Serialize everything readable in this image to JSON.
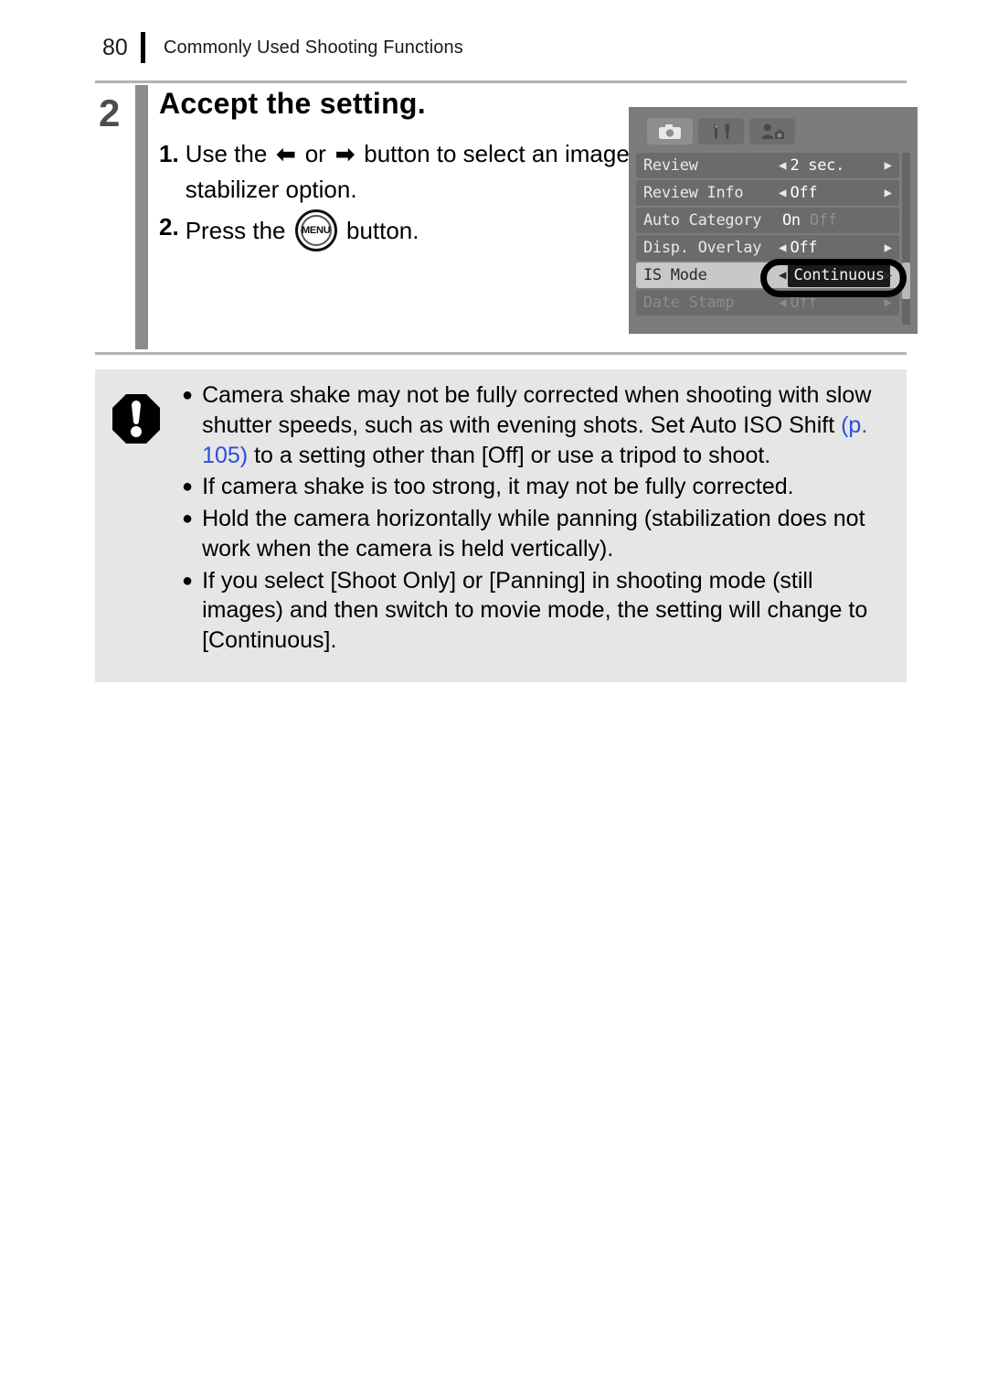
{
  "header": {
    "page_number": "80",
    "title": "Commonly Used Shooting Functions"
  },
  "step": {
    "number": "2",
    "title": "Accept the setting.",
    "substeps": [
      {
        "num": "1.",
        "text_before": "Use the",
        "arrow_left": "⬅",
        "between": "or",
        "arrow_right": "➡",
        "text_after": "button to select an image stabilizer option."
      },
      {
        "num": "2.",
        "text_before": "Press the",
        "button_label": "MENU",
        "text_after": "button."
      }
    ]
  },
  "lcd": {
    "tabs": [
      {
        "name": "camera-tab",
        "icon": "camera-icon",
        "active": true
      },
      {
        "name": "tools-tab",
        "icon": "wrench-screwdriver-icon",
        "active": false
      },
      {
        "name": "my-camera-tab",
        "icon": "person-camera-icon",
        "active": false
      }
    ],
    "rows": [
      {
        "label": "Review",
        "value": "2 sec.",
        "style": "arrows"
      },
      {
        "label": "Review Info",
        "value": "Off",
        "style": "arrows"
      },
      {
        "label": "Auto Category",
        "value_on": "On",
        "value_off": "Off",
        "style": "onoff"
      },
      {
        "label": "Disp. Overlay",
        "value": "Off",
        "style": "arrows"
      },
      {
        "label": "IS Mode",
        "value": "Continuous",
        "style": "selected"
      },
      {
        "label": "Date Stamp",
        "value": "Off",
        "style": "arrows-faded"
      }
    ],
    "caret_left": "◀",
    "caret_right": "▶"
  },
  "caution": {
    "icon": "exclamation-octagon-icon",
    "items": [
      {
        "text_before": "Camera shake may not be fully corrected when shooting with slow shutter speeds, such as with evening shots. Set Auto ISO Shift ",
        "link": "(p. 105)",
        "text_after": " to a setting other than [Off] or use a tripod to shoot."
      },
      {
        "text_before": "If camera shake is too strong, it may not be fully corrected."
      },
      {
        "text_before": "Hold the camera horizontally while panning (stabilization does not work when the camera is held vertically)."
      },
      {
        "text_before": "If you select [Shoot Only] or [Panning] in shooting mode (still images) and then switch to movie mode, the setting will change to [Continuous]."
      }
    ],
    "bullet": "●"
  },
  "colors": {
    "link": "#2a4fd6",
    "caution_bg": "#e6e6e6",
    "step_bar": "#8c8c8c",
    "lcd_bg": "#7c7c7c"
  }
}
